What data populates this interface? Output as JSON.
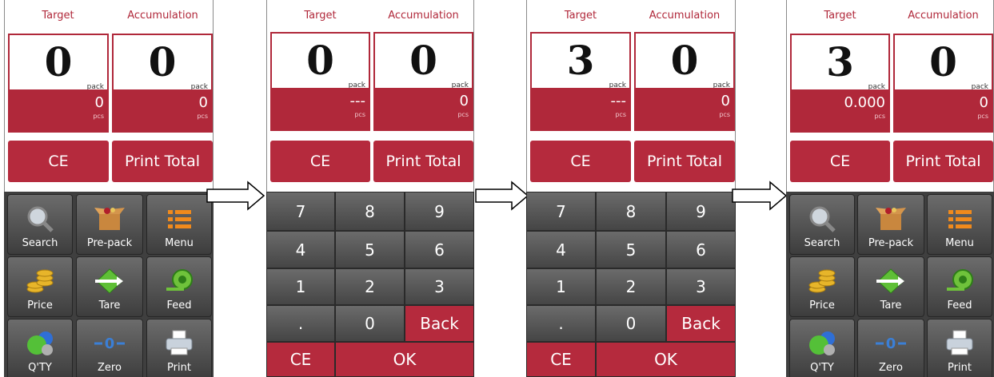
{
  "labels": {
    "target": "Target",
    "accumulation": "Accumulation",
    "unit_pack": "pack",
    "unit_pcs": "pcs"
  },
  "buttons": {
    "ce": "CE",
    "print_total": "Print Total",
    "ok": "OK",
    "back": "Back"
  },
  "screens": [
    {
      "target_value": "0",
      "accum_value": "0",
      "target_sub": "0",
      "accum_sub": "0"
    },
    {
      "target_value": "0",
      "accum_value": "0",
      "target_sub": "---",
      "accum_sub": "0"
    },
    {
      "target_value": "3",
      "accum_value": "0",
      "target_sub": "---",
      "accum_sub": "0"
    },
    {
      "target_value": "3",
      "accum_value": "0",
      "target_sub": "0.000",
      "accum_sub": "0"
    }
  ],
  "menu_tiles": [
    {
      "label": "Search",
      "icon": "magnifier-icon"
    },
    {
      "label": "Pre-pack",
      "icon": "box-icon"
    },
    {
      "label": "Menu",
      "icon": "list-icon"
    },
    {
      "label": "Price",
      "icon": "coins-icon"
    },
    {
      "label": "Tare",
      "icon": "tare-arrow-icon"
    },
    {
      "label": "Feed",
      "icon": "paper-roll-icon"
    },
    {
      "label": "Q'TY",
      "icon": "balls-icon"
    },
    {
      "label": "Zero",
      "icon": "zero-icon"
    },
    {
      "label": "Print",
      "icon": "printer-icon"
    }
  ],
  "keypad": {
    "rows": [
      [
        "7",
        "8",
        "9"
      ],
      [
        "4",
        "5",
        "6"
      ],
      [
        "1",
        "2",
        "3"
      ],
      [
        ".",
        "0",
        "Back"
      ]
    ],
    "bottom": [
      "CE",
      "OK"
    ]
  },
  "colors": {
    "accent": "#b0283a",
    "dark": "#3f3f3f"
  }
}
